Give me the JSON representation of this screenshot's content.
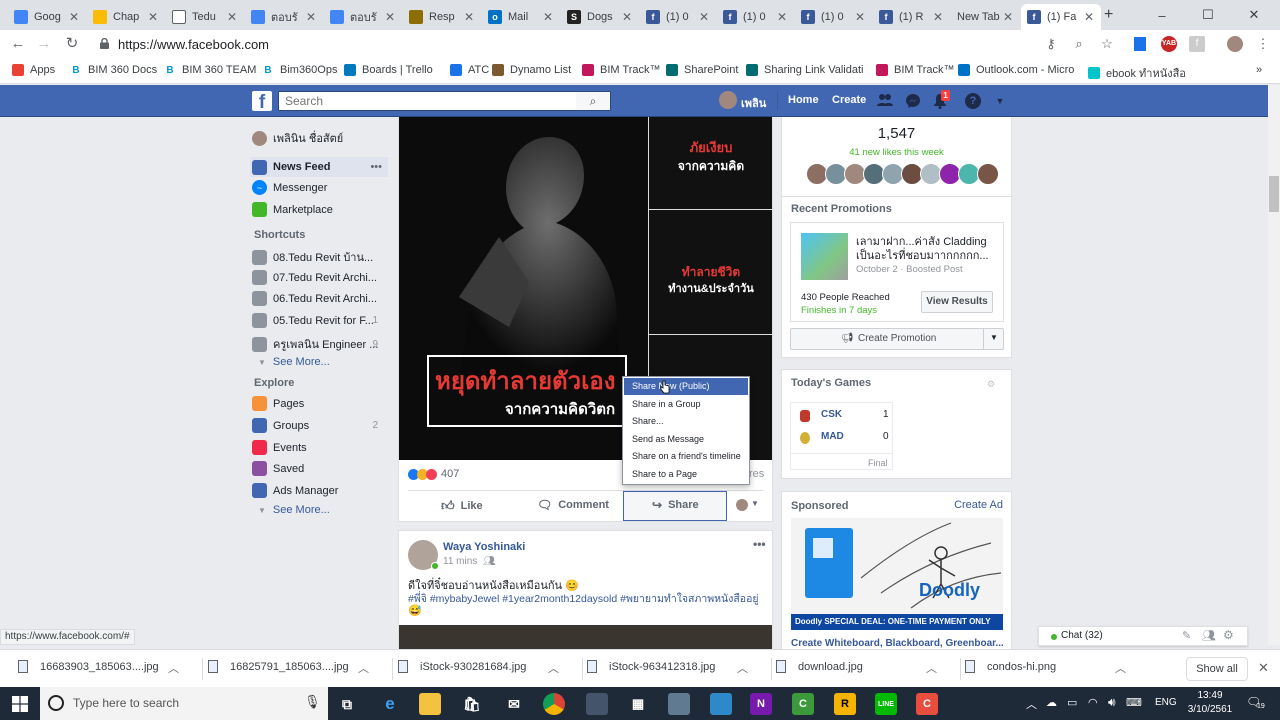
{
  "tabs": [
    {
      "title": "Goog",
      "icon": "docs-icon",
      "color": "#4285f4"
    },
    {
      "title": "Chap",
      "icon": "drive-icon",
      "color": "#fbbc04"
    },
    {
      "title": "Tedu",
      "icon": "page-icon",
      "color": "#ffffff"
    },
    {
      "title": "ตอบรั",
      "icon": "docs-icon",
      "color": "#4285f4"
    },
    {
      "title": "ตอบรั",
      "icon": "docs-icon",
      "color": "#4285f4"
    },
    {
      "title": "Resp",
      "icon": "coin-icon",
      "color": "#8d6e00"
    },
    {
      "title": "Mail",
      "icon": "outlook-icon",
      "color": "#0072c6"
    },
    {
      "title": "Dogs",
      "icon": "s-icon",
      "color": "#222222"
    },
    {
      "title": "(1) 0",
      "icon": "facebook-icon",
      "color": "#3b5998"
    },
    {
      "title": "(1) 0",
      "icon": "facebook-icon",
      "color": "#3b5998"
    },
    {
      "title": "(1) 0",
      "icon": "facebook-icon",
      "color": "#3b5998"
    },
    {
      "title": "(1) R",
      "icon": "facebook-icon",
      "color": "#3b5998"
    },
    {
      "title": "New Tab",
      "icon": "",
      "color": ""
    },
    {
      "title": "(1) Fa",
      "icon": "facebook-icon",
      "color": "#3b5998",
      "active": true
    }
  ],
  "address": {
    "url": "https://www.facebook.com"
  },
  "bookmarks": [
    {
      "label": "Apps",
      "icon": "apps-grid-icon",
      "color": "#e94235"
    },
    {
      "label": "BIM 360 Docs",
      "icon": "b-icon",
      "color": "#0696d7"
    },
    {
      "label": "BIM 360 TEAM",
      "icon": "b-icon",
      "color": "#0696d7"
    },
    {
      "label": "Bim360Ops",
      "icon": "b-icon",
      "color": "#0696d7"
    },
    {
      "label": "Boards | Trello",
      "icon": "trello-icon",
      "color": "#0079bf"
    },
    {
      "label": "ATC",
      "icon": "atc-icon",
      "color": "#1a73e8"
    },
    {
      "label": "Dynamo List",
      "icon": "dynamo-icon",
      "color": "#7a5a2e"
    },
    {
      "label": "BIM Track™",
      "icon": "bimtrack-icon",
      "color": "#c2185b"
    },
    {
      "label": "SharePoint",
      "icon": "sharepoint-icon",
      "color": "#036c70"
    },
    {
      "label": "Sharing Link Validati",
      "icon": "sharepoint-icon",
      "color": "#036c70"
    },
    {
      "label": "BIM Track™",
      "icon": "bimtrack-icon",
      "color": "#c2185b"
    },
    {
      "label": "Outlook.com - Micro",
      "icon": "outlook-icon",
      "color": "#0072c6"
    },
    {
      "label": "ebook ทำหนังสือ",
      "icon": "c-icon",
      "color": "#00c4cc"
    }
  ],
  "fb": {
    "search_placeholder": "Search",
    "profile_name": "เพลิน",
    "home": "Home",
    "create": "Create",
    "notif_count": "1",
    "brand_color": "#4267b2"
  },
  "left": {
    "profile": "เพลินิน ชื่อสัตย์",
    "feed": [
      {
        "label": "News Feed",
        "icon": "newsfeed-icon",
        "color": "#4267b2"
      },
      {
        "label": "Messenger",
        "icon": "messenger-icon",
        "color": "#0084ff"
      },
      {
        "label": "Marketplace",
        "icon": "marketplace-icon",
        "color": "#42b72a"
      }
    ],
    "shortcuts_heading": "Shortcuts",
    "shortcuts": [
      {
        "label": "08.Tedu Revit บ้าน...",
        "count": ""
      },
      {
        "label": "07.Tedu Revit Archi...",
        "count": ""
      },
      {
        "label": "06.Tedu Revit Archi...",
        "count": ""
      },
      {
        "label": "05.Tedu Revit for F...",
        "count": "1"
      },
      {
        "label": "ครูเพลนิน Engineer ...",
        "count": "9"
      }
    ],
    "see_more": "See More...",
    "explore_heading": "Explore",
    "explore": [
      {
        "label": "Pages",
        "icon": "flag-icon",
        "color": "#f7923b",
        "count": ""
      },
      {
        "label": "Groups",
        "icon": "groups-icon",
        "color": "#4267b2",
        "count": "2"
      },
      {
        "label": "Events",
        "icon": "calendar-icon",
        "color": "#f02849",
        "count": ""
      },
      {
        "label": "Saved",
        "icon": "bookmark-icon",
        "color": "#8c50a0",
        "count": ""
      },
      {
        "label": "Ads Manager",
        "icon": "chart-bars-icon",
        "color": "#4267b2",
        "count": ""
      }
    ],
    "see_more2": "See More..."
  },
  "post1": {
    "text_main": "หยุดทำลายตัวเอง",
    "text_sub": "จากความคิดวิตก",
    "panel1_a": "ภัยเงียบ",
    "panel1_b": "จากความคิด",
    "panel2_a": "ทำลายชีวิต",
    "panel2_b": "ทำงาน&ประจำวัน",
    "reactions": "407",
    "shares_suffix": "res",
    "like": "Like",
    "comment": "Comment",
    "share": "Share"
  },
  "share_menu": [
    "Share Now (Public)",
    "Share in a Group",
    "Share...",
    "Send as Message",
    "Share on a friend's timeline",
    "Share to a Page"
  ],
  "post2": {
    "author": "Waya Yoshinaki",
    "time": "11 mins",
    "text1": "ดีใจที่จิ๋ชอบอ่านหนังสือเหมือนกัน 😊",
    "text2": "#พี่จิ #mybabyJewel #1year2month12daysold #พยายามทำใจสภาพหนังสืออยู่",
    "text3": "😅"
  },
  "right": {
    "likes_total": "1,547",
    "likes_new": "41 new likes this week",
    "promotions_heading": "Recent Promotions",
    "promo_title": "เลามาฝาก...ค่าสั่ง Cladding เป็นอะไรที่ชอบมาากกกกก...",
    "promo_meta": "October 2 · Boosted Post",
    "promo_reach": "430 People Reached",
    "promo_status": "Finishes in 7 days",
    "view_results": "View Results",
    "create_promotion": "Create Promotion",
    "games_heading": "Today's Games",
    "games": [
      {
        "team": "CSK",
        "score": "1"
      },
      {
        "team": "MAD",
        "score": "0"
      }
    ],
    "game_state": "Final",
    "sponsored": "Sponsored",
    "create_ad": "Create Ad",
    "ad_banner": "Doodly SPECIAL DEAL: ONE-TIME PAYMENT ONLY",
    "ad_caption": "Create Whiteboard, Blackboard, Greenboar..."
  },
  "chat": {
    "label": "Chat (32)"
  },
  "status_url": "https://www.facebook.com/#",
  "downloads": [
    "16683903_185063....jpg",
    "16825791_185063....jpg",
    "iStock-930281684.jpg",
    "iStock-963412318.jpg",
    "download.jpg",
    "condos-hi.png"
  ],
  "show_all": "Show all",
  "taskbar": {
    "search_placeholder": "Type here to search",
    "lang": "ENG",
    "time": "13:49",
    "date": "3/10/2561",
    "notif_count": "19"
  }
}
